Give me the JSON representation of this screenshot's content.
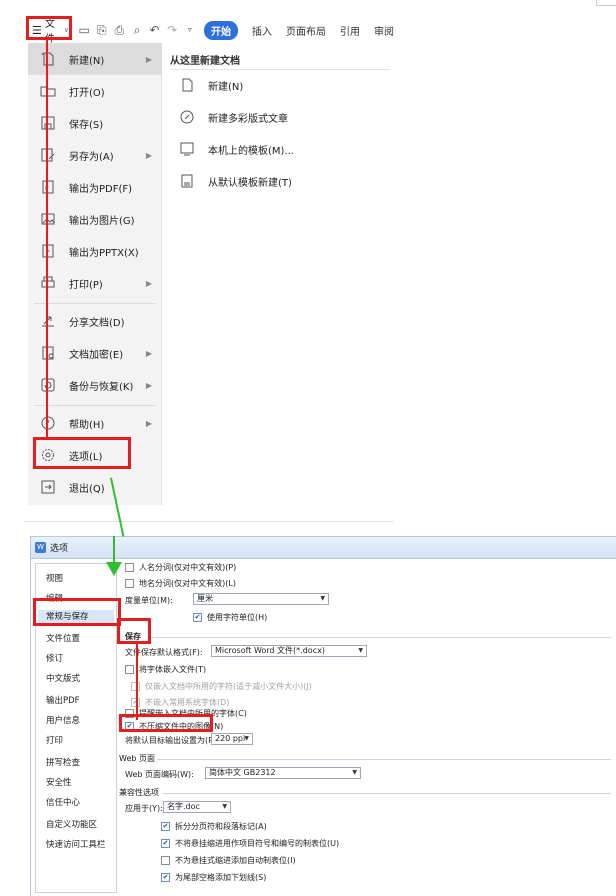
{
  "toolbar": {
    "file_label": "文件",
    "tabs": [
      "开始",
      "插入",
      "页面布局",
      "引用",
      "审阅"
    ]
  },
  "file_menu": {
    "items": [
      {
        "label": "新建(N)",
        "icon": "new-doc-icon",
        "arrow": true
      },
      {
        "label": "打开(O)",
        "icon": "folder-open-icon",
        "arrow": false
      },
      {
        "label": "保存(S)",
        "icon": "save-icon",
        "arrow": false
      },
      {
        "label": "另存为(A)",
        "icon": "save-as-icon",
        "arrow": true
      },
      {
        "label": "输出为PDF(F)",
        "icon": "export-pdf-icon",
        "arrow": false
      },
      {
        "label": "输出为图片(G)",
        "icon": "export-image-icon",
        "arrow": false
      },
      {
        "label": "输出为PPTX(X)",
        "icon": "export-pptx-icon",
        "arrow": false
      },
      {
        "label": "打印(P)",
        "icon": "printer-icon",
        "arrow": true
      },
      {
        "label": "分享文档(D)",
        "icon": "share-icon",
        "arrow": false
      },
      {
        "label": "文档加密(E)",
        "icon": "encrypt-icon",
        "arrow": true
      },
      {
        "label": "备份与恢复(K)",
        "icon": "backup-icon",
        "arrow": true
      },
      {
        "label": "帮助(H)",
        "icon": "help-icon",
        "arrow": true
      },
      {
        "label": "选项(L)",
        "icon": "gear-icon",
        "arrow": false
      },
      {
        "label": "退出(Q)",
        "icon": "exit-icon",
        "arrow": false
      }
    ]
  },
  "new_panel": {
    "title": "从这里新建文档",
    "items": [
      {
        "label": "新建(N)",
        "icon": "new-doc-icon"
      },
      {
        "label": "新建多彩版式文章",
        "icon": "colorful-article-icon"
      },
      {
        "label": "本机上的模板(M)...",
        "icon": "local-template-icon"
      },
      {
        "label": "从默认模板新建(T)",
        "icon": "default-template-icon"
      }
    ]
  },
  "dialog": {
    "title": "选项",
    "nav": [
      "视图",
      "编辑",
      "常规与保存",
      "文件位置",
      "修订",
      "中文版式",
      "输出PDF",
      "用户信息",
      "打印",
      "拼写检查",
      "安全性",
      "信任中心",
      "自定义功能区",
      "快速访问工具栏"
    ],
    "top_options": [
      {
        "label": "人名分词(仅对中文有效)(P)",
        "checked": false
      },
      {
        "label": "地名分词(仅对中文有效)(L)",
        "checked": false
      }
    ],
    "measure_label": "度量单位(M):",
    "measure_value": "厘米",
    "char_unit": {
      "label": "使用字符单位(H)",
      "checked": true
    },
    "save_section": "保存",
    "format_label": "文件保存默认格式(F):",
    "format_value": "Microsoft Word 文件(*.docx)",
    "embed_fonts": {
      "label": "将字体嵌入文件(T)",
      "checked": false
    },
    "embed_used_chars": {
      "label": "仅嵌入文档中所用的字符(适于减小文件大小)(J)",
      "checked": false
    },
    "no_system_fonts": {
      "label": "不嵌入常用系统字体(D)",
      "checked": true
    },
    "remind_fonts": {
      "label": "提醒嵌入文档中所用的字体(C)",
      "checked": false
    },
    "no_compress": {
      "label": "不压缩文件中的图像(N)",
      "checked": true
    },
    "ppi_label": "将默认目标输出设置为(P):",
    "ppi_value": "220 ppi",
    "web_section": "Web 页面",
    "web_encoding_label": "Web 页面编码(W):",
    "web_encoding_value": "简体中文 GB2312",
    "compat_section": "兼容性选项",
    "apply_label": "应用于(Y):",
    "apply_value": "名字.doc",
    "compat_options": [
      {
        "label": "拆分分页符和段落标记(A)",
        "checked": true
      },
      {
        "label": "不将悬挂缩进用作项目符号和编号的制表位(U)",
        "checked": true
      },
      {
        "label": "不为悬挂式缩进添加自动制表位(I)",
        "checked": false
      },
      {
        "label": "为尾部空格添加下划线(S)",
        "checked": true
      }
    ]
  },
  "colors": {
    "highlight_red": "#e41e1e",
    "arrow_green": "#2fbf2f",
    "accent_blue": "#2f6fd8"
  }
}
